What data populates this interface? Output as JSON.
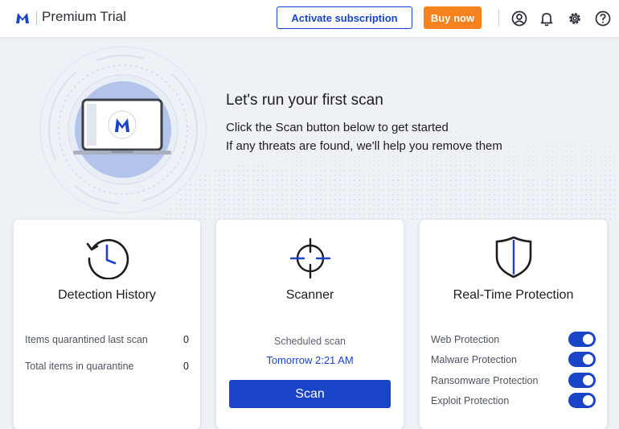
{
  "header": {
    "app_title": "Premium Trial",
    "activate_label": "Activate subscription",
    "buy_label": "Buy now",
    "icons": [
      "account-icon",
      "notification-bell-icon",
      "settings-gear-icon",
      "help-icon"
    ]
  },
  "hero": {
    "title": "Let's run your first scan",
    "line1": "Click the Scan button below to get started",
    "line2": "If any threats are found, we'll help you remove them"
  },
  "detection": {
    "title": "Detection History",
    "stats": [
      {
        "label": "Items quarantined last scan",
        "value": "0"
      },
      {
        "label": "Total items in quarantine",
        "value": "0"
      }
    ]
  },
  "scanner": {
    "title": "Scanner",
    "scheduled_label": "Scheduled scan",
    "scheduled_time": "Tomorrow 2:21 AM",
    "scan_label": "Scan"
  },
  "protection": {
    "title": "Real-Time Protection",
    "items": [
      {
        "label": "Web Protection",
        "enabled": true
      },
      {
        "label": "Malware Protection",
        "enabled": true
      },
      {
        "label": "Ransomware Protection",
        "enabled": true
      },
      {
        "label": "Exploit Protection",
        "enabled": true
      }
    ]
  },
  "colors": {
    "accent": "#1a44c8",
    "buy": "#f5821f",
    "background": "#eef1f6"
  }
}
